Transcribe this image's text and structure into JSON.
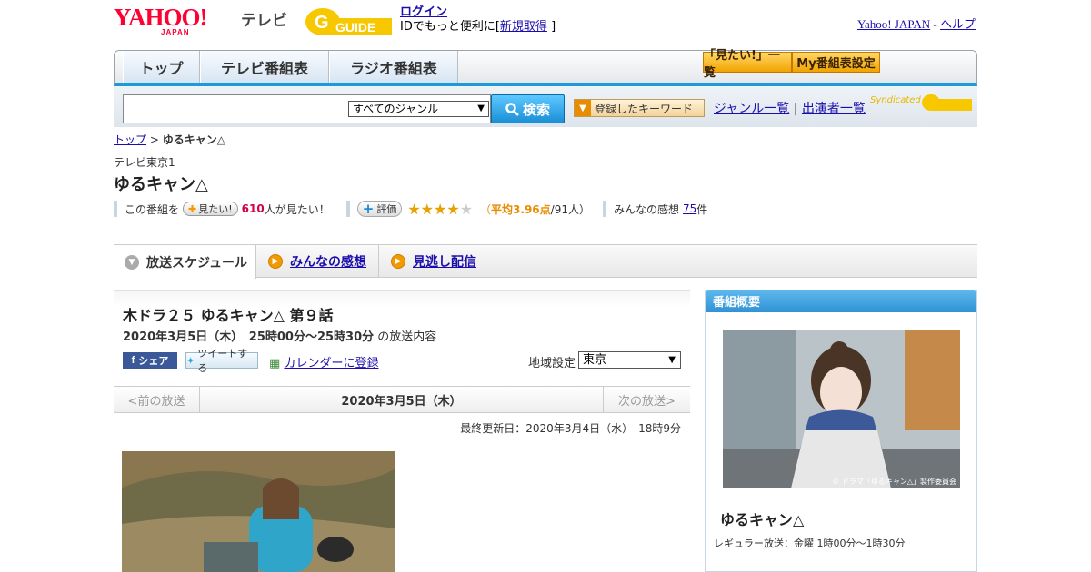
{
  "header": {
    "brand": "YAHOO!",
    "brand_sub": "JAPAN",
    "section": "テレビ",
    "gguide": "GUIDE",
    "login_label": "ログイン",
    "login_text": "IDでもっと便利に[",
    "signup_label": "新規取得",
    "login_text_end": "]",
    "yahoo_japan_link": "Yahoo! JAPAN",
    "separator": "-",
    "help_link": "ヘルプ"
  },
  "gnav": {
    "tabs": [
      {
        "label": "トップ"
      },
      {
        "label": "テレビ番組表"
      },
      {
        "label": "ラジオ番組表"
      }
    ],
    "mitai_list": "「見たい!」一覧",
    "my_guide": "My番組表設定"
  },
  "search": {
    "genre_selected": "すべてのジャンル",
    "button": "検索",
    "keyword_button": "登録したキーワード",
    "genre_list": "ジャンル一覧",
    "divider": "|",
    "performer_list": "出演者一覧",
    "syndicated": "Syndicated"
  },
  "breadcrumb": {
    "top": "トップ",
    "sep": ">",
    "current": "ゆるキャン△"
  },
  "program": {
    "station": "テレビ東京1",
    "title": "ゆるキャン△",
    "mitai_prefix": "この番組を",
    "mitai_button": "見たい!",
    "mitai_count": "610",
    "mitai_suffix": "人が見たい！",
    "rating_button": "評価",
    "rating_value": 3.96,
    "rating_max": 5,
    "stars_glyph": "★★★★★",
    "avg_open": "（",
    "avg_label": "平均3.96点",
    "avg_voters": "/91人）",
    "impressions_label": "みんなの感想",
    "impressions_count": "75",
    "impressions_unit": "件"
  },
  "tabs": [
    {
      "label": "放送スケジュール",
      "active": true
    },
    {
      "label": "みんなの感想",
      "active": false
    },
    {
      "label": "見逃し配信",
      "active": false
    }
  ],
  "episode": {
    "title": "木ドラ２５ ゆるキャン△ 第９話",
    "date_time": "2020年3月5日（木）　25時00分～25時30分",
    "date_suffix": "の放送内容",
    "facebook_share": "シェア",
    "tweet": "ツイートする",
    "calendar": "カレンダーに登録",
    "region_label": "地域設定",
    "region_selected": "東京"
  },
  "episode_nav": {
    "prev": "<前の放送",
    "current": "2020年3月5日（木）",
    "next": "次の放送>"
  },
  "updated": "最終更新日：2020年3月4日（水）　18時9分",
  "sidebar": {
    "heading": "番組概要",
    "copyright": "© ドラマ「ゆるキャン△」製作委員会",
    "title": "ゆるキャン△",
    "regular": "レギュラー放送：金曜 1時00分～1時30分"
  },
  "colors": {
    "accent_blue": "#1e9ad9",
    "yahoo_red": "#ff0033",
    "star": "#e8a100",
    "count_red": "#d0004b"
  }
}
